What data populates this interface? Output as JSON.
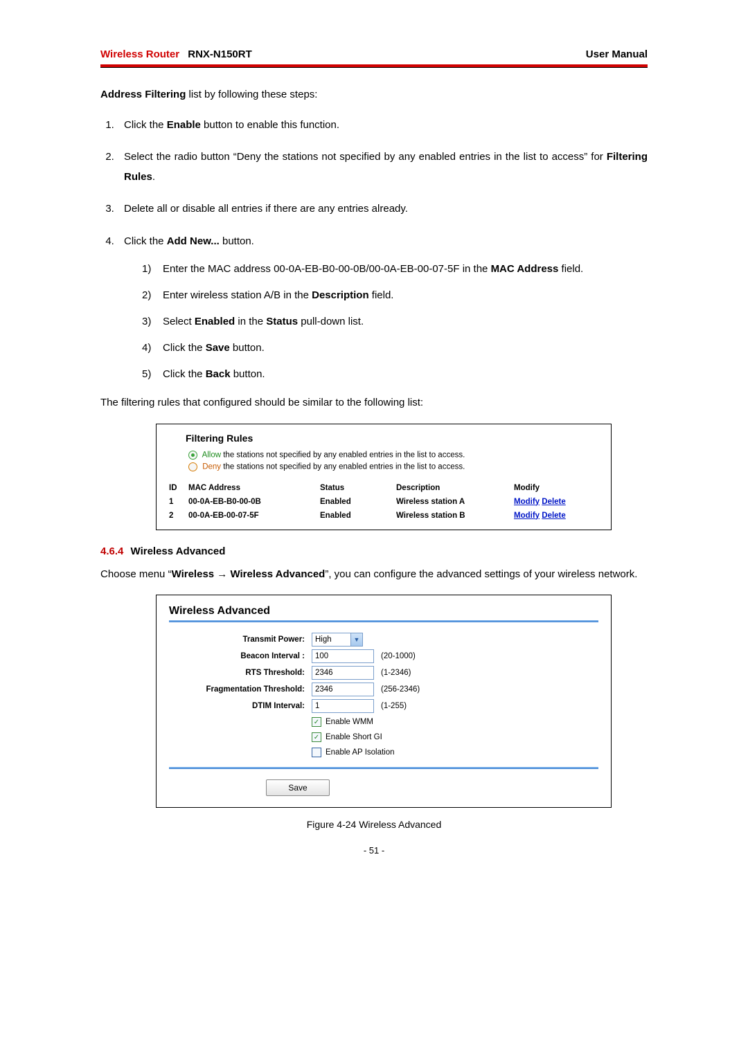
{
  "header": {
    "brand": "Wireless Router",
    "model": "RNX-N150RT",
    "right": "User Manual"
  },
  "intro": {
    "strong": "Address Filtering",
    "rest": " list by following these steps:"
  },
  "steps": {
    "s1_a": "Click the ",
    "s1_b": "Enable",
    "s1_c": " button to enable this function.",
    "s2_a": "Select the radio button “Deny the stations not specified by any enabled entries in the list to access” for ",
    "s2_b": "Filtering Rules",
    "s2_c": ".",
    "s3": "Delete all or disable all entries if there are any entries already.",
    "s4_a": "Click the ",
    "s4_b": "Add New...",
    "s4_c": " button.",
    "sub1_a": "Enter the MAC address 00-0A-EB-B0-00-0B/00-0A-EB-00-07-5F in the ",
    "sub1_b": "MAC Address",
    "sub1_c": " field.",
    "sub2_a": "Enter wireless station A/B in the ",
    "sub2_b": "Description",
    "sub2_c": " field.",
    "sub3_a": "Select ",
    "sub3_b": "Enabled",
    "sub3_c": " in the ",
    "sub3_d": "Status",
    "sub3_e": " pull-down list.",
    "sub4_a": "Click the ",
    "sub4_b": "Save",
    "sub4_c": " button.",
    "sub5_a": "Click the ",
    "sub5_b": "Back",
    "sub5_c": " button."
  },
  "midtext": "The filtering rules that configured should be similar to the following list:",
  "fig1": {
    "title": "Filtering Rules",
    "allow_word": "Allow",
    "allow_rest": " the stations not specified by any enabled entries in the list to access.",
    "deny_word": "Deny",
    "deny_rest": " the stations not specified by any enabled entries in the list to access.",
    "cols": {
      "id": "ID",
      "mac": "MAC Address",
      "status": "Status",
      "desc": "Description",
      "mod": "Modify"
    },
    "rows": [
      {
        "id": "1",
        "mac": "00-0A-EB-B0-00-0B",
        "status": "Enabled",
        "desc": "Wireless station A",
        "modify": "Modify",
        "delete": "Delete"
      },
      {
        "id": "2",
        "mac": "00-0A-EB-00-07-5F",
        "status": "Enabled",
        "desc": "Wireless station B",
        "modify": "Modify",
        "delete": "Delete"
      }
    ]
  },
  "section": {
    "num": "4.6.4",
    "title": "Wireless Advanced",
    "para_a": "Choose menu “",
    "para_b": "Wireless → Wireless Advanced",
    "para_c": "”, you can configure the advanced settings of your wireless network."
  },
  "fig2": {
    "title": "Wireless Advanced",
    "labels": {
      "power": "Transmit Power:",
      "beacon": "Beacon Interval :",
      "rts": "RTS Threshold:",
      "frag": "Fragmentation Threshold:",
      "dtim": "DTIM Interval:"
    },
    "values": {
      "power": "High",
      "beacon": "100",
      "rts": "2346",
      "frag": "2346",
      "dtim": "1"
    },
    "ranges": {
      "beacon": "(20-1000)",
      "rts": "(1-2346)",
      "frag": "(256-2346)",
      "dtim": "(1-255)"
    },
    "checks": {
      "wmm": "Enable WMM",
      "gi": "Enable Short GI",
      "iso": "Enable AP Isolation"
    },
    "save": "Save"
  },
  "figcap": "Figure 4-24 Wireless Advanced",
  "pagenum": "- 51 -"
}
